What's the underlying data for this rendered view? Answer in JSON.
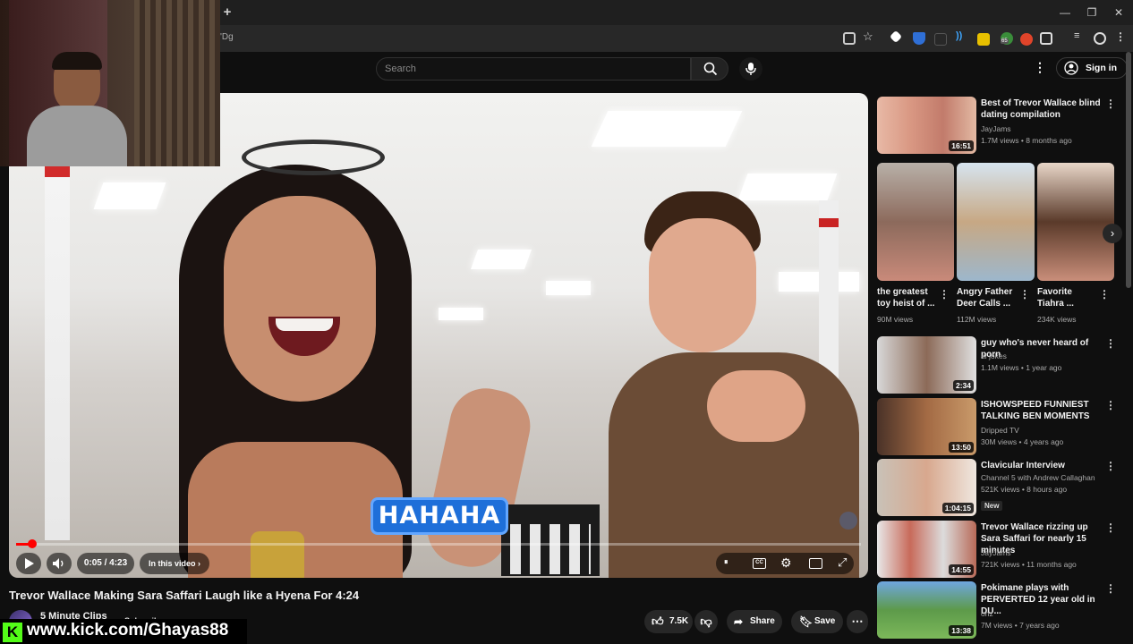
{
  "browser": {
    "new_tab": "+",
    "url_fragment": "'Dg",
    "window_controls": [
      "—",
      "❐",
      "✕"
    ],
    "extension_badge": "65"
  },
  "header": {
    "search_placeholder": "Search",
    "sign_in": "Sign in",
    "icons": [
      "search-icon",
      "mic-icon",
      "more-icon",
      "account-icon"
    ]
  },
  "player": {
    "caption": "HAHAHA",
    "time": "0:05 / 4:23",
    "in_this_video": "In this video",
    "progress_fraction": 0.019
  },
  "video": {
    "title": "Trevor Wallace Making Sara Saffari Laugh like a Hyena For 4:24",
    "channel": "5 Minute Clips",
    "subscribe": "Subscribe",
    "likes": "7.5K",
    "share": "Share",
    "save": "Save"
  },
  "overlay": {
    "kick_logo": "K",
    "kick_url": "www.kick.com/Ghayas88"
  },
  "recommendations": [
    {
      "title": "Best of Trevor Wallace blind dating compilation",
      "channel": "JayJams",
      "meta": "1.7M views • 8 months ago",
      "duration": "16:51"
    },
    {
      "title": "guy who's never heard of porn",
      "channel": "al jokes",
      "meta": "1.1M views • 1 year ago",
      "duration": "2:34"
    },
    {
      "title": "ISHOWSPEED FUNNIEST TALKING BEN MOMENTS",
      "channel": "Dripped TV",
      "meta": "30M views • 4 years ago",
      "duration": "13:50"
    },
    {
      "title": "Clavicular Interview",
      "channel": "Channel 5 with Andrew Callaghan",
      "meta": "521K views • 8 hours ago",
      "duration": "1:04:15",
      "badge": "New"
    },
    {
      "title": "Trevor Wallace rizzing up Sara Saffari for nearly 15 minutes",
      "channel": "JayJams",
      "meta": "721K views • 11 months ago",
      "duration": "14:55"
    },
    {
      "title": "Pokimane plays with PERVERTED 12 year old in DU...",
      "channel": "onz",
      "meta": "7M views • 7 years ago",
      "duration": "13:38"
    }
  ],
  "shorts": [
    {
      "title": "the greatest toy heist of ...",
      "views": "90M views"
    },
    {
      "title": "Angry Father Deer Calls ...",
      "views": "112M views"
    },
    {
      "title": "Favorite Tiahra ...",
      "views": "234K views"
    }
  ],
  "colors": {
    "accent": "#ff0000",
    "caption_bg": "#1e6fd9",
    "kick": "#53fc18",
    "background": "#0f0f0f"
  }
}
